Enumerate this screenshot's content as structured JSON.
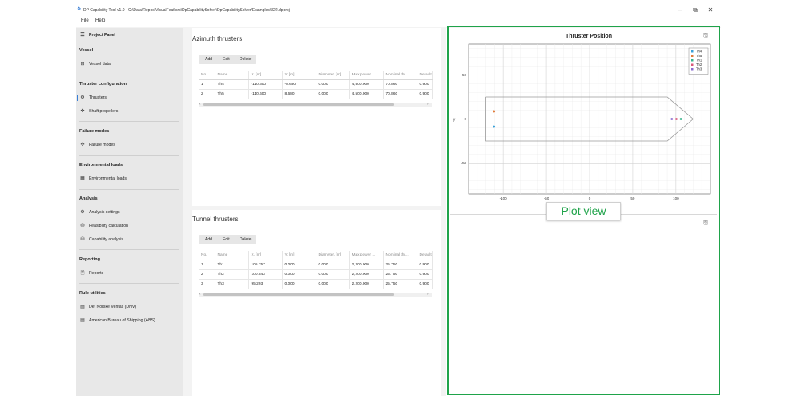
{
  "window": {
    "title": "DP Capability Tool v1.0 - C:\\Data\\Repos\\VisualFeat\\src\\DpCapabilitySolver\\DpCapabilitySolver\\Examples\\822.dpproj",
    "controls": {
      "minimize": "–",
      "maximize": "⧉",
      "close": "✕"
    }
  },
  "menu": {
    "file": "File",
    "help": "Help"
  },
  "sidebar": {
    "project_panel": "Project Panel",
    "vessel_header": "Vessel",
    "vessel_data": "Vessel data",
    "thruster_config_header": "Thruster configuration",
    "thrusters": "Thrusters",
    "shaft_propellers": "Shaft propellers",
    "failure_modes_header": "Failure modes",
    "failure_modes": "Failure modes",
    "env_loads_header": "Environmental loads",
    "env_loads": "Environmental loads",
    "analysis_header": "Analysis",
    "analysis_settings": "Analysis settings",
    "feasibility_calc": "Feasibility calculation",
    "capability_analysis": "Capability analysis",
    "reporting_header": "Reporting",
    "reports": "Reports",
    "rule_utilities_header": "Rule utilities",
    "dnv": "Det Norske Veritas (DNV)",
    "abs": "American Bureau of Shipping (ABS)"
  },
  "azimuth": {
    "title": "Azimuth thrusters",
    "toolbar": {
      "add": "Add",
      "edit": "Edit",
      "delete": "Delete"
    },
    "columns": [
      "No.",
      "Name",
      "X. [m]",
      "Y. [m]",
      "Diameter. [m]",
      "Max power ...",
      "Nominal thr...",
      "Default tl"
    ],
    "rows": [
      [
        "1",
        "Th4",
        "-110.600",
        "-8.680",
        "0.000",
        "4,500.000",
        "70.860",
        "0.900"
      ],
      [
        "2",
        "Th5",
        "-110.600",
        "8.680",
        "0.000",
        "4,500.000",
        "70.860",
        "0.900"
      ]
    ]
  },
  "tunnel": {
    "title": "Tunnel thrusters",
    "toolbar": {
      "add": "Add",
      "edit": "Edit",
      "delete": "Delete"
    },
    "columns": [
      "No.",
      "Name",
      "X. [m]",
      "Y. [m]",
      "Diameter. [m]",
      "Max power ...",
      "Nominal thr...",
      "Default tl"
    ],
    "rows": [
      [
        "1",
        "Th1",
        "105.757",
        "0.000",
        "0.000",
        "2,200.000",
        "25.750",
        "0.900"
      ],
      [
        "2",
        "Th2",
        "100.543",
        "0.000",
        "0.000",
        "2,200.000",
        "25.750",
        "0.900"
      ],
      [
        "3",
        "Th3",
        "95.293",
        "0.000",
        "0.000",
        "2,200.000",
        "25.750",
        "0.900"
      ]
    ]
  },
  "plot": {
    "title": "Thruster Position",
    "callout": "Plot view",
    "icons": {
      "save": "save-icon"
    },
    "colors": {
      "Th4": "#3aa0d8",
      "Th5": "#e07b39",
      "Th1": "#35b38a",
      "Th2": "#d85a7a",
      "Th3": "#8a6ad0",
      "hull": "#9a9a9a",
      "highlight": "#1fa34a"
    },
    "chart_data": {
      "type": "scatter",
      "title": "Thruster Position",
      "xlabel": "",
      "ylabel": "y",
      "xlim": [
        -140,
        140
      ],
      "ylim": [
        -85,
        85
      ],
      "xticks": [
        "-100",
        "-50",
        "0",
        "50",
        "100"
      ],
      "yticks": [
        "50",
        "0",
        "-50"
      ],
      "grid": true,
      "legend_position": "top-right",
      "series": [
        {
          "name": "Th4",
          "x": [
            -110.6
          ],
          "y": [
            -8.68
          ]
        },
        {
          "name": "Th5",
          "x": [
            -110.6
          ],
          "y": [
            8.68
          ]
        },
        {
          "name": "Th1",
          "x": [
            105.757
          ],
          "y": [
            0
          ]
        },
        {
          "name": "Th2",
          "x": [
            100.543
          ],
          "y": [
            0
          ]
        },
        {
          "name": "Th3",
          "x": [
            95.293
          ],
          "y": [
            0
          ]
        }
      ],
      "hull_outline": {
        "x": [
          -120,
          90,
          120,
          90,
          -120,
          -120
        ],
        "y": [
          25,
          25,
          0,
          -25,
          -25,
          25
        ]
      }
    }
  }
}
